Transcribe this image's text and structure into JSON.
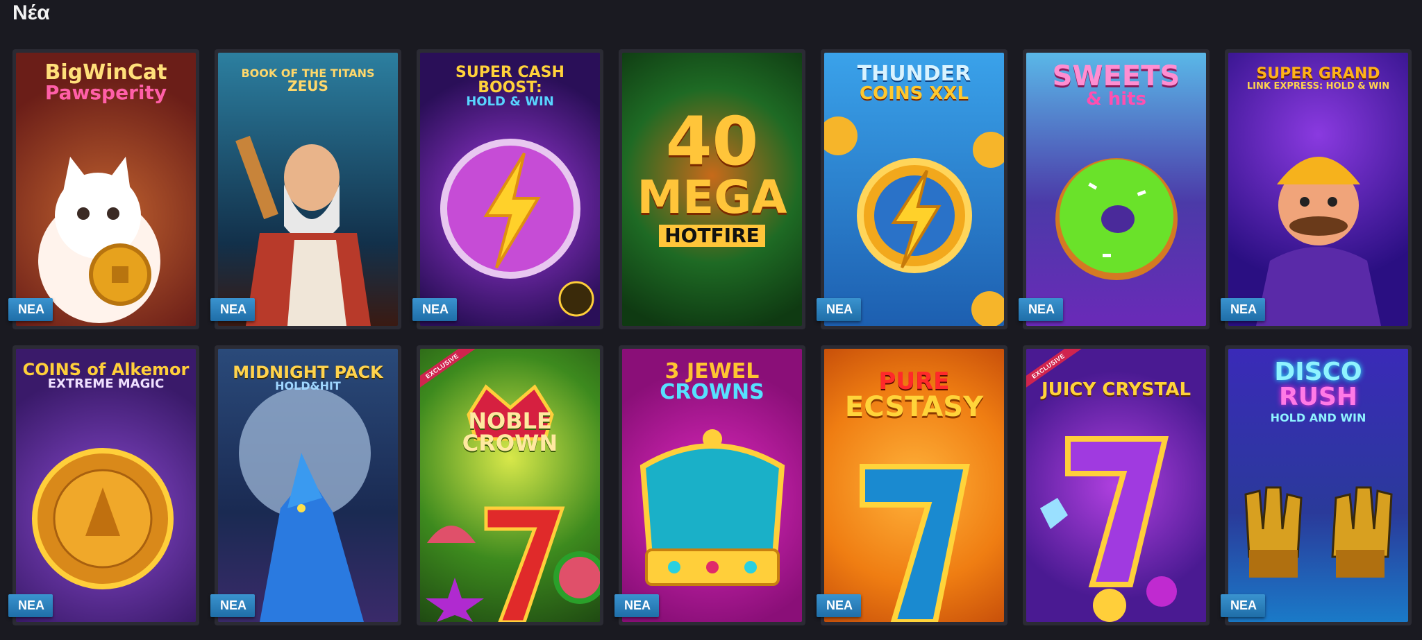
{
  "section": {
    "title": "Νέα"
  },
  "badge_label": "ΝΕΑ",
  "exclusive_label": "EXCLUSIVE",
  "games": [
    {
      "line1": "BigWinCat",
      "line2": "Pawsperity",
      "badge": true,
      "bg": "#7a2a1f",
      "color1": "#ffe07a",
      "color2": "#ff5fa8"
    },
    {
      "line1": "BOOK OF THE TITANS",
      "line2": "ZEUS",
      "badge": true,
      "bg": "#1f4e6e",
      "color1": "#ffd86b",
      "color2": "#ffd86b"
    },
    {
      "line1": "SUPER CASH BOOST:",
      "line2": "HOLD & WIN",
      "badge": true,
      "bg": "#3a1a6e",
      "color1": "#ffd23a",
      "color2": "#58d4ff"
    },
    {
      "line1": "40",
      "line2": "MEGA",
      "line3": "HOTFIRE",
      "badge": false,
      "bg": "#1f5e22",
      "color1": "#ffc53a",
      "color2": "#ffffff"
    },
    {
      "line1": "THUNDER",
      "line2": "COINS XXL",
      "badge": true,
      "bg": "#2a8fd6",
      "color1": "#d9f3ff",
      "color2": "#ffc82e"
    },
    {
      "line1": "SWEETS",
      "line2": "& hits",
      "badge": true,
      "bg": "#4b3aa8",
      "color1": "#ff8ed2",
      "color2": "#ff4fb0"
    },
    {
      "line1": "SUPER GRAND",
      "line2": "LINK EXPRESS: HOLD & WIN",
      "badge": true,
      "bg": "#3a1496",
      "color1": "#ffb21a",
      "color2": "#ffd34d"
    },
    {
      "line1": "COINS of Alkemor",
      "line2": "EXTREME MAGIC",
      "badge": true,
      "bg": "#4e2a7e",
      "color1": "#ffcf3a",
      "color2": "#f0e0ff"
    },
    {
      "line1": "MIDNIGHT PACK",
      "line2": "HOLD&HIT",
      "badge": true,
      "bg": "#1e3562",
      "color1": "#ffd34d",
      "color2": "#9fd6ff"
    },
    {
      "line1": "NOBLE",
      "line2": "CROWN",
      "badge": false,
      "exclusive": true,
      "bg": "#3d8a1e",
      "color1": "#ffe9a0",
      "color2": "#ffe9a0"
    },
    {
      "line1": "3 JEWEL",
      "line2": "CROWNS",
      "badge": true,
      "bg": "#b21a95",
      "color1": "#ffc531",
      "color2": "#56e1ff"
    },
    {
      "line1": "PURE",
      "line2": "ECSTASY",
      "badge": true,
      "bg": "#ef7d12",
      "color1": "#ff2a2a",
      "color2": "#ffd43a"
    },
    {
      "line1": "JUICY CRYSTAL",
      "line2": "",
      "badge": false,
      "exclusive": true,
      "bg": "#5a1aa0",
      "color1": "#ffd23a",
      "color2": "#ffd23a"
    },
    {
      "line1": "DISCO",
      "line2": "RUSH",
      "line3": "HOLD AND WIN",
      "badge": true,
      "bg": "#2a3aa8",
      "color1": "#8ff3ff",
      "color2": "#ff7ae6"
    }
  ]
}
